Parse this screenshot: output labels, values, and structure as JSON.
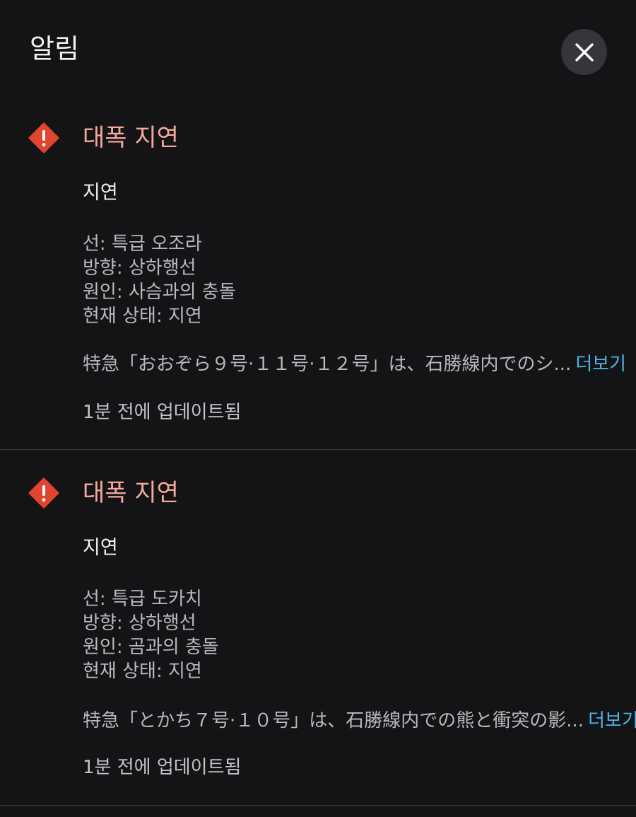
{
  "header": {
    "title": "알림",
    "close_icon": "close-icon"
  },
  "alerts": [
    {
      "icon": "warning-diamond-icon",
      "title": "대폭 지연",
      "status": "지연",
      "details": {
        "line": "선: 특급 오조라",
        "direction": "방향: 상하행선",
        "cause": "원인: 사슴과의 충돌",
        "current_status": "현재 상태: 지연"
      },
      "description": "特急「おおぞら９号·１１号·１２号」は、石勝線内でのシ...",
      "more_label": "더보기",
      "updated": "1분 전에 업데이트됨"
    },
    {
      "icon": "warning-diamond-icon",
      "title": "대폭 지연",
      "status": "지연",
      "details": {
        "line": "선: 특급 도카치",
        "direction": "방향: 상하행선",
        "cause": "원인: 곰과의 충돌",
        "current_status": "현재 상태: 지연"
      },
      "description": "特急「とかち７号·１０号」は、石勝線内での熊と衝突の影...",
      "more_label": "더보기",
      "updated": "1분 전에 업데이트됨"
    }
  ],
  "colors": {
    "background": "#141416",
    "alert_title": "#f5a89e",
    "warning_icon": "#e0452f",
    "link": "#4db4e6",
    "close_button_bg": "#35363a"
  }
}
